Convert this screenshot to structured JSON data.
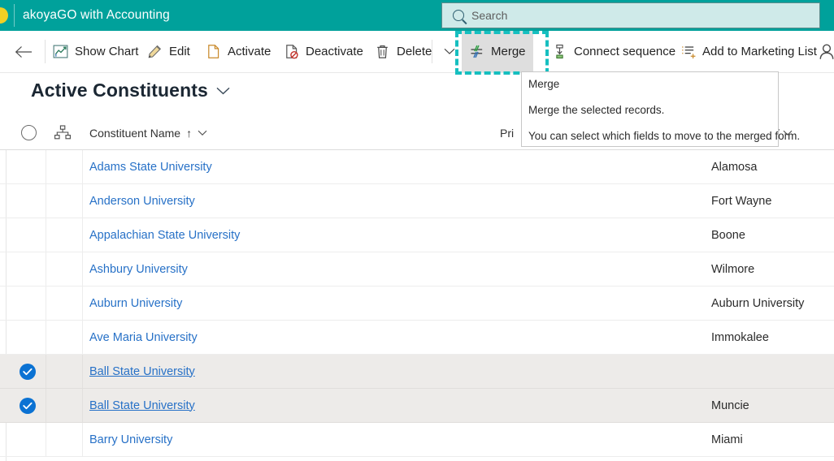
{
  "app": {
    "title": "akoyaGO with Accounting",
    "brand_color": "#00A19B",
    "logo_color": "#F2D024",
    "logo_icon": "circle-logo"
  },
  "search": {
    "placeholder": "Search",
    "icon": "search-icon"
  },
  "commandbar": {
    "back_icon": "arrow-left-icon",
    "overflow_icon": "chevron-down-icon",
    "user_icon": "person-icon",
    "commands": [
      {
        "label": "Show Chart",
        "icon": "chart-icon"
      },
      {
        "label": "Edit",
        "icon": "pencil-icon"
      },
      {
        "label": "Activate",
        "icon": "activate-document-icon"
      },
      {
        "label": "Deactivate",
        "icon": "deactivate-document-icon"
      },
      {
        "label": "Delete",
        "icon": "trash-icon"
      },
      {
        "label": "Merge",
        "icon": "merge-icon"
      },
      {
        "label": "Connect sequence",
        "icon": "connect-sequence-icon"
      },
      {
        "label": "Add to Marketing List",
        "icon": "add-to-list-icon"
      }
    ],
    "highlight": {
      "target": "Merge",
      "color": "#16BFC0",
      "style": "dashed"
    }
  },
  "tooltip": {
    "title": "Merge",
    "line2": "Merge the selected records.",
    "line3": "You can select which fields to move to the merged form."
  },
  "view": {
    "title": "Active Constituents",
    "chevron_icon": "chevron-down-icon"
  },
  "grid": {
    "select_all_icon": "circle-unchecked-icon",
    "hierarchy_icon": "hierarchy-icon",
    "columns": [
      {
        "label": "Constituent Name",
        "sort": "↑",
        "chevron": "⌄"
      },
      {
        "label": "Pri",
        "chevron": "⌄"
      }
    ],
    "rows": [
      {
        "name": "Adams State University",
        "city": "Alamosa",
        "selected": false
      },
      {
        "name": "Anderson University",
        "city": "Fort Wayne",
        "selected": false
      },
      {
        "name": "Appalachian State University",
        "city": "Boone",
        "selected": false
      },
      {
        "name": "Ashbury University",
        "city": "Wilmore",
        "selected": false
      },
      {
        "name": "Auburn University",
        "city": "Auburn University",
        "selected": false
      },
      {
        "name": "Ave Maria University",
        "city": "Immokalee",
        "selected": false
      },
      {
        "name": "Ball State University",
        "city": "",
        "selected": true
      },
      {
        "name": "Ball State University",
        "city": "Muncie",
        "selected": true
      },
      {
        "name": "Barry University",
        "city": "Miami",
        "selected": false
      }
    ]
  }
}
